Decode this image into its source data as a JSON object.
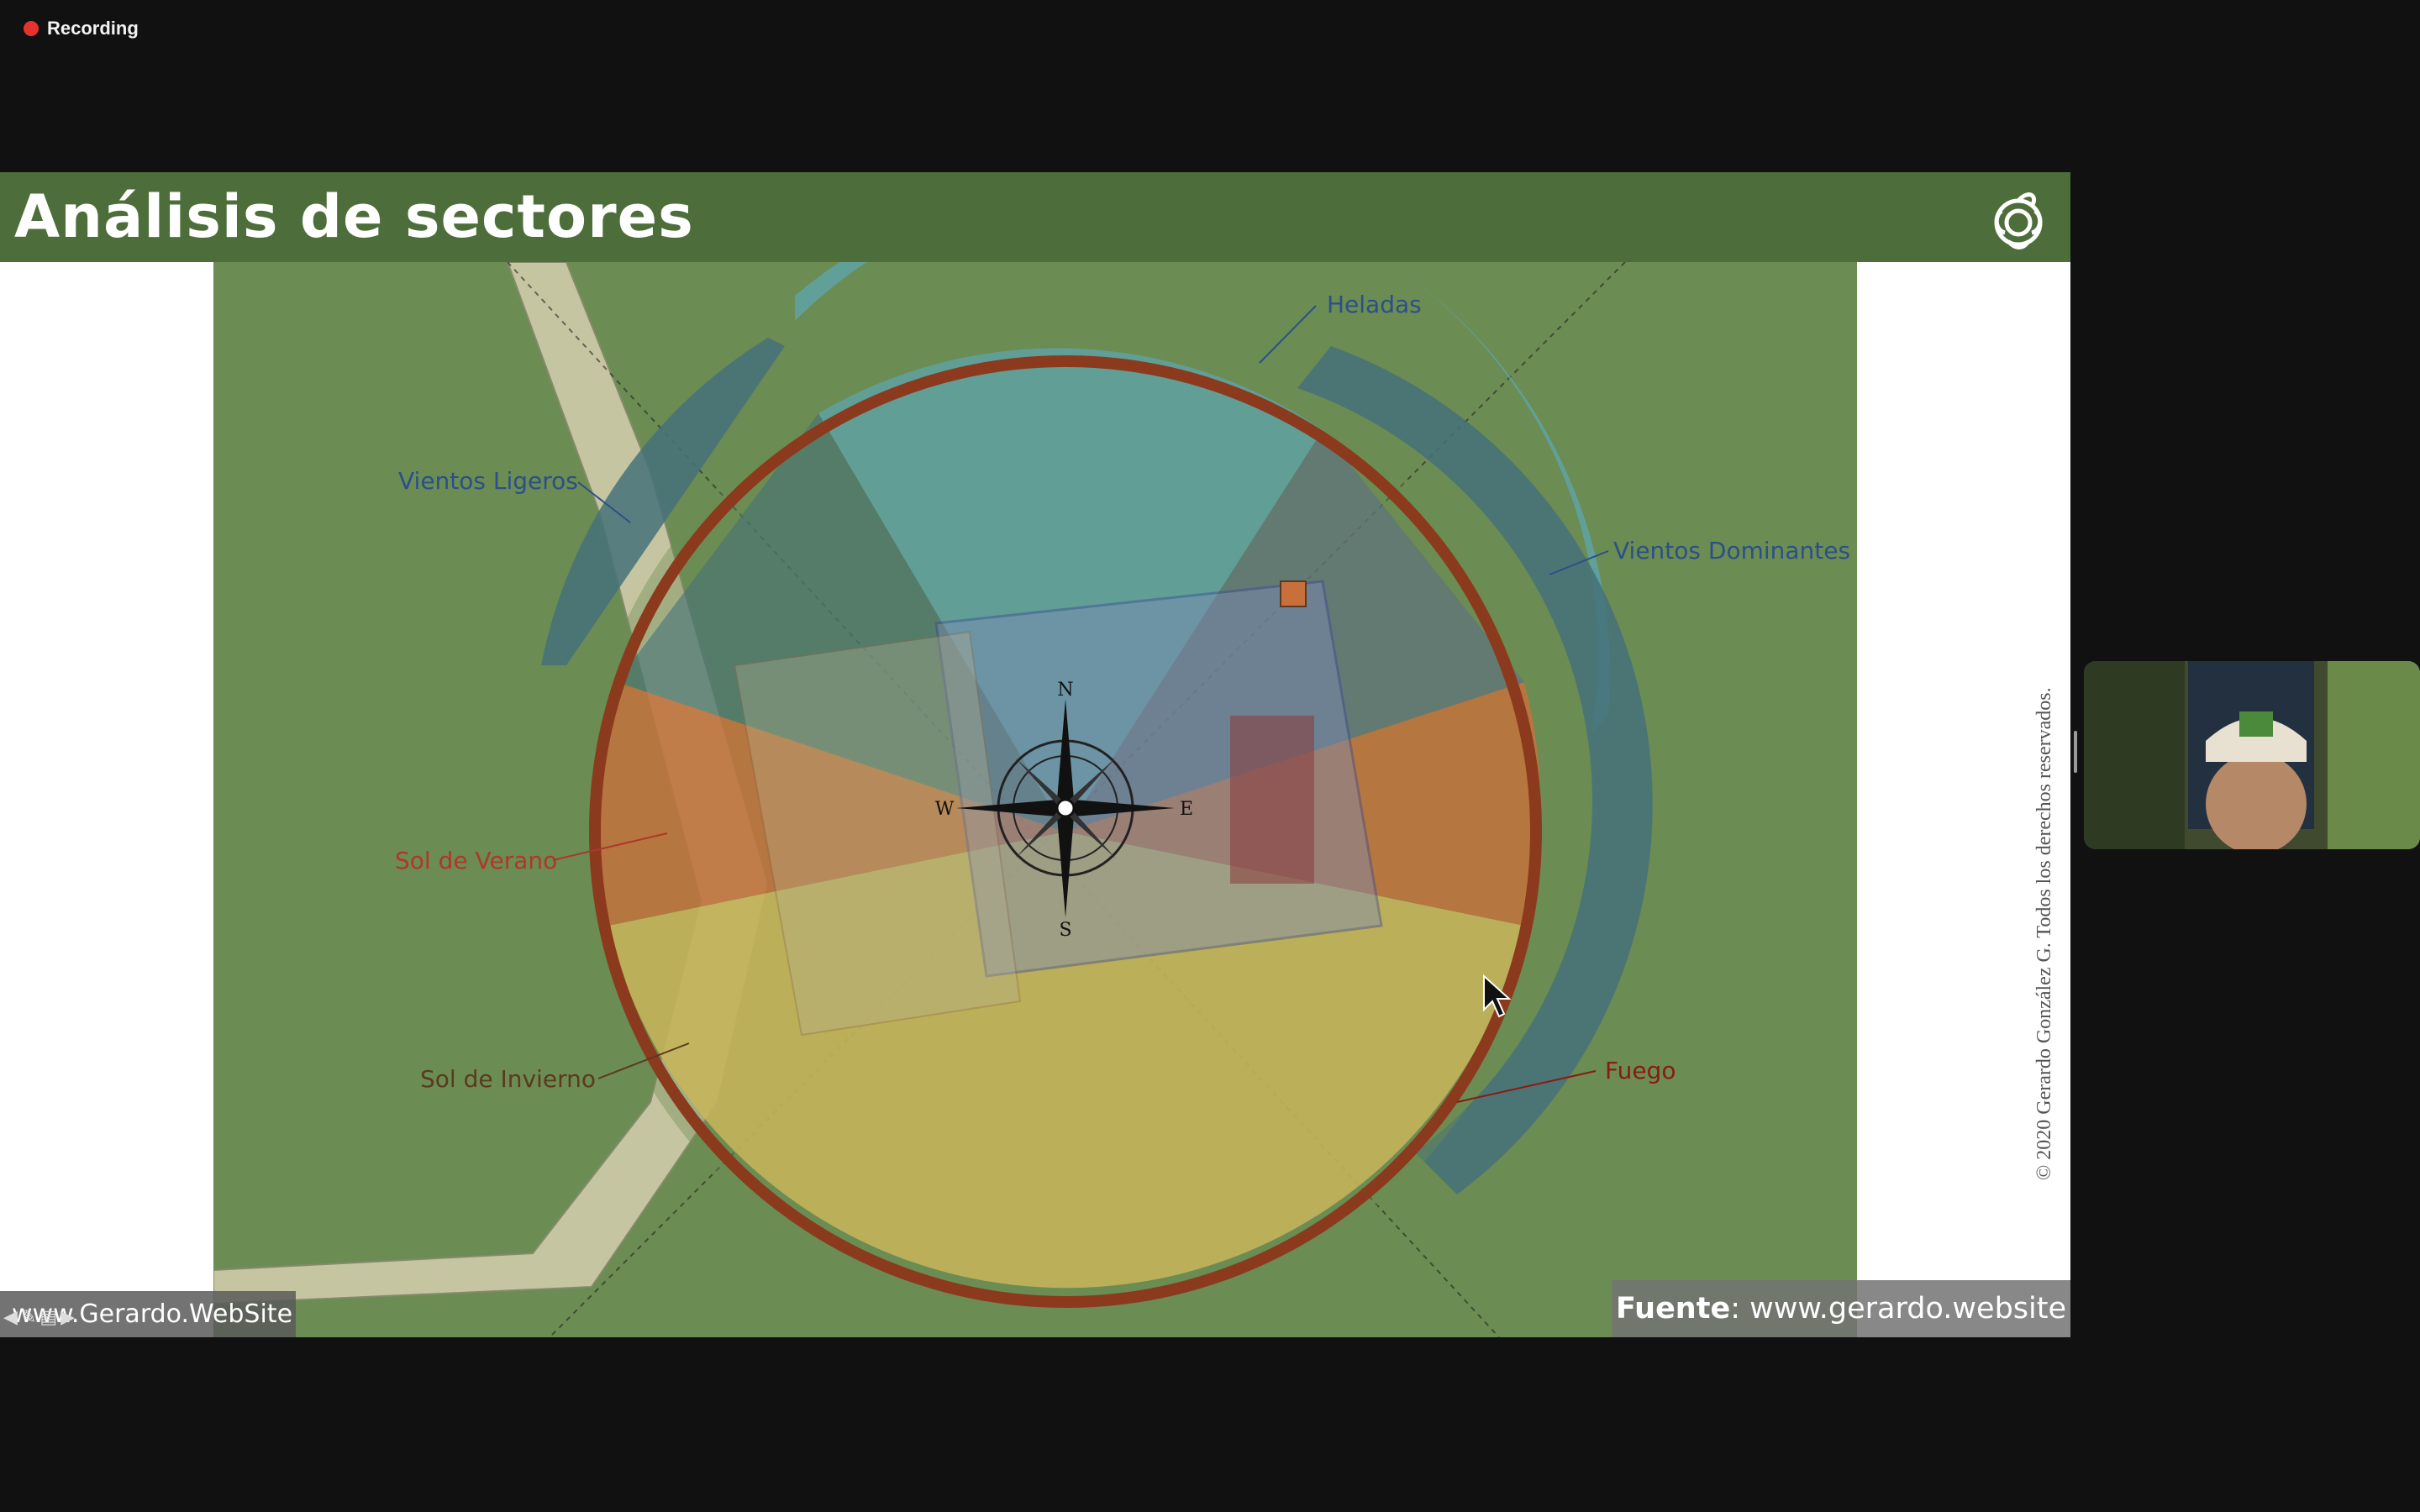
{
  "recording": {
    "label": "Recording",
    "dot_color": "#e5322d"
  },
  "slide": {
    "title": "Análisis de sectores",
    "header_color": "#4d6e3a",
    "copyright": "© 2020 Gerardo González G. Todos los derechos reservados.",
    "source_prefix": "Fuente",
    "source_text": ": www.gerardo.website",
    "website_watermark": "www.Gerardo.WebSite",
    "map": {
      "labels": {
        "heladas": "Heladas",
        "vientos_ligeros": "Vientos Ligeros",
        "vientos_dominantes": "Vientos Dominantes",
        "sol_verano": "Sol de Verano",
        "sol_invierno": "Sol de Invierno",
        "fuego": "Fuego"
      },
      "compass": {
        "n": "N",
        "s": "S",
        "e": "E",
        "w": "W"
      },
      "colors": {
        "ground": "#6b8c52",
        "heladas": "#5fa3a6",
        "vientos": "#45717a",
        "sol_verano": "#c8703b",
        "sol_invierno": "#c9b55a",
        "fuego": "#8b3a1e",
        "path": "#d6d0b0"
      }
    }
  },
  "participant_video": {
    "name_icon": "participant-video"
  }
}
